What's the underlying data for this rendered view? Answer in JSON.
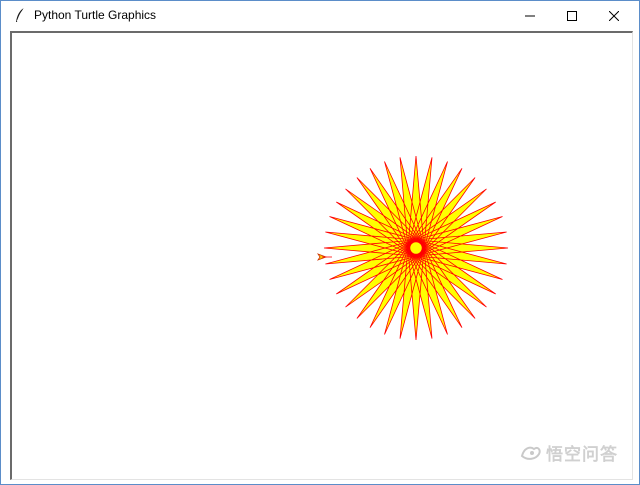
{
  "window": {
    "title": "Python Turtle Graphics",
    "app_icon": "feather-icon",
    "controls": {
      "minimize": "minimize-icon",
      "maximize": "maximize-icon",
      "close": "close-icon"
    }
  },
  "canvas": {
    "background": "#ffffff",
    "drawing": {
      "shape": "star-burst",
      "points": 36,
      "fill_color": "#ffff00",
      "pen_color": "#ff0000",
      "turtle_color": "#ffcc00",
      "turtle_icon": "turtle-arrow-icon"
    }
  },
  "watermark": {
    "text": "悟空问答",
    "icon": "wukong-logo-icon"
  },
  "colors": {
    "window_border": "#5b8dc9",
    "title_text": "#000000"
  }
}
